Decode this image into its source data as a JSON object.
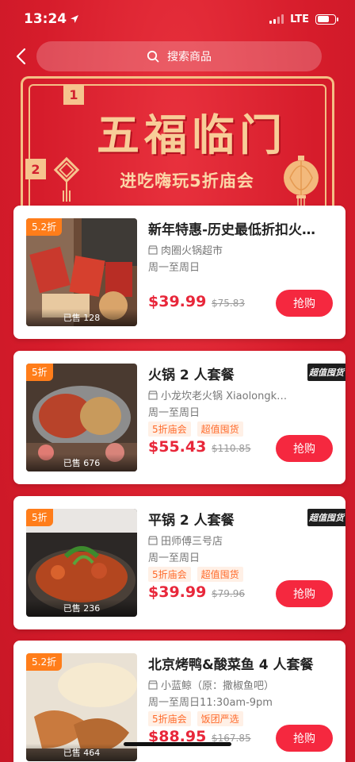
{
  "status": {
    "time": "13:24",
    "network": "LTE"
  },
  "header": {
    "search_placeholder": "搜索商品"
  },
  "banner": {
    "title": "五福临门",
    "subtitle": "进吃嗨玩5折庙会",
    "num1": "1",
    "num2": "2"
  },
  "products": [
    {
      "discount": "5.2折",
      "sold": "已售 128",
      "title": "新年特惠-历史最低折扣火…",
      "shop": "肉圈火锅超市",
      "time": "周一至周日",
      "tags": [],
      "price": "$39.99",
      "orig_price": "$75.83",
      "buy": "抢购",
      "badge": ""
    },
    {
      "discount": "5折",
      "sold": "已售 676",
      "title": "火锅 2 人套餐",
      "shop": "小龙坎老火锅 Xiaolongk…",
      "time": "周一至周日",
      "tags": [
        "5折庙会",
        "超值囤货"
      ],
      "price": "$55.43",
      "orig_price": "$110.85",
      "buy": "抢购",
      "badge": "超值囤货"
    },
    {
      "discount": "5折",
      "sold": "已售 236",
      "title": "平锅 2 人套餐",
      "shop": "田师傅三号店",
      "time": "周一至周日",
      "tags": [
        "5折庙会",
        "超值囤货"
      ],
      "price": "$39.99",
      "orig_price": "$79.96",
      "buy": "抢购",
      "badge": "超值囤货"
    },
    {
      "discount": "5.2折",
      "sold": "已售 464",
      "title": "北京烤鸭&酸菜鱼 4 人套餐",
      "shop": "小蓝鲸（原：撒椒鱼吧）",
      "time": "周一至周日11:30am-9pm",
      "tags": [
        "5折庙会",
        "饭团严选"
      ],
      "price": "$88.95",
      "orig_price": "$167.85",
      "buy": "抢购",
      "badge": ""
    }
  ],
  "colors": {
    "background": "#d9202f",
    "accent": "#f5283f",
    "discount_tag": "#ff7d1a"
  }
}
